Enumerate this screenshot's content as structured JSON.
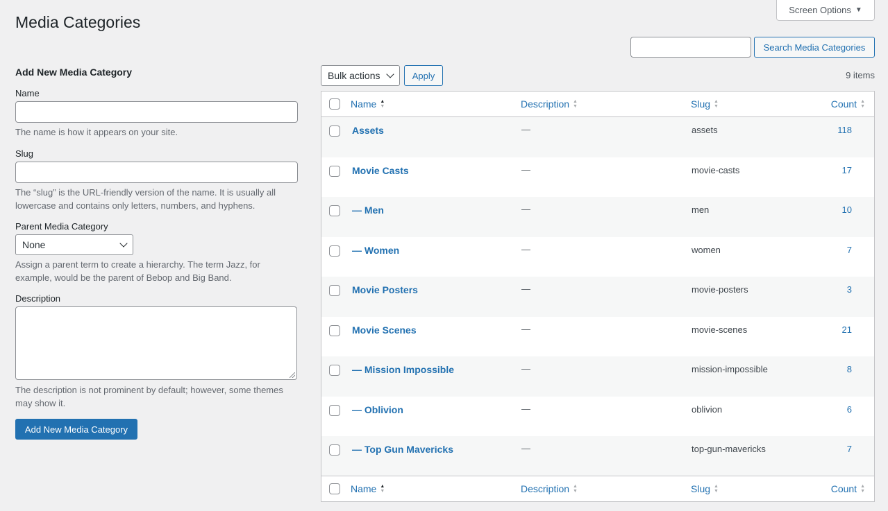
{
  "header": {
    "title": "Media Categories",
    "screen_options": "Screen Options",
    "search_button": "Search Media Categories",
    "search_value": ""
  },
  "form": {
    "title": "Add New Media Category",
    "name_label": "Name",
    "name_hint": "The name is how it appears on your site.",
    "slug_label": "Slug",
    "slug_hint": "The “slug” is the URL-friendly version of the name. It is usually all lowercase and contains only letters, numbers, and hyphens.",
    "parent_label": "Parent Media Category",
    "parent_value": "None",
    "parent_hint": "Assign a parent term to create a hierarchy. The term Jazz, for example, would be the parent of Bebop and Big Band.",
    "desc_label": "Description",
    "desc_hint": "The description is not prominent by default; however, some themes may show it.",
    "submit": "Add New Media Category"
  },
  "toolbar": {
    "bulk_actions": "Bulk actions",
    "apply": "Apply",
    "items_count": "9 items"
  },
  "table": {
    "columns": {
      "name": "Name",
      "description": "Description",
      "slug": "Slug",
      "count": "Count"
    },
    "rows": [
      {
        "name": "Assets",
        "description": "—",
        "slug": "assets",
        "count": "118"
      },
      {
        "name": "Movie Casts",
        "description": "—",
        "slug": "movie-casts",
        "count": "17"
      },
      {
        "name": "— Men",
        "description": "—",
        "slug": "men",
        "count": "10"
      },
      {
        "name": "— Women",
        "description": "—",
        "slug": "women",
        "count": "7"
      },
      {
        "name": "Movie Posters",
        "description": "—",
        "slug": "movie-posters",
        "count": "3"
      },
      {
        "name": "Movie Scenes",
        "description": "—",
        "slug": "movie-scenes",
        "count": "21"
      },
      {
        "name": "— Mission Impossible",
        "description": "—",
        "slug": "mission-impossible",
        "count": "8"
      },
      {
        "name": "— Oblivion",
        "description": "—",
        "slug": "oblivion",
        "count": "6"
      },
      {
        "name": "— Top Gun Mavericks",
        "description": "—",
        "slug": "top-gun-mavericks",
        "count": "7"
      }
    ]
  }
}
